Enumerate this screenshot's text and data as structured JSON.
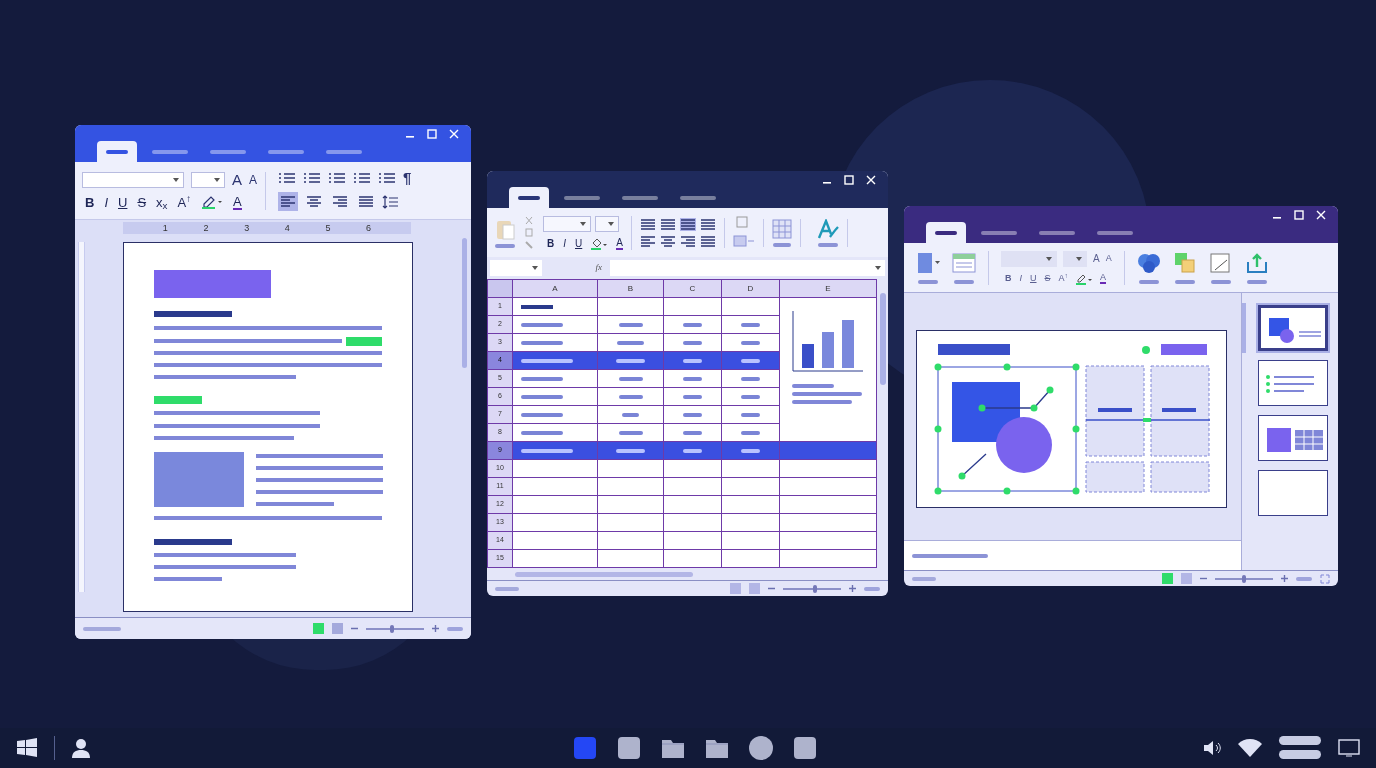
{
  "document_window": {
    "tabs": [
      {
        "selected": true
      },
      {
        "selected": false
      },
      {
        "selected": false
      },
      {
        "selected": false
      },
      {
        "selected": false
      }
    ],
    "font_size_buttons": [
      "A",
      "A"
    ],
    "pilcrow": "¶",
    "format_buttons": [
      "B",
      "I",
      "U",
      "S",
      "x$_{x}$",
      "A$^{↑}$"
    ],
    "font_color": "A",
    "align_buttons": [
      {
        "selected": true
      },
      {
        "selected": false
      },
      {
        "selected": false
      },
      {
        "selected": false
      }
    ],
    "ruler_numbers": [
      "1",
      "2",
      "3",
      "4",
      "5",
      "6"
    ],
    "zoom": {
      "level": 0.45
    }
  },
  "spreadsheet_window": {
    "tabs": [
      {
        "selected": true
      },
      {
        "selected": false
      },
      {
        "selected": false
      },
      {
        "selected": false
      }
    ],
    "format_buttons": [
      "B",
      "I",
      "U"
    ],
    "font_color": "A",
    "formula_label": "fx",
    "columns": [
      "A",
      "B",
      "C",
      "D",
      "E"
    ],
    "rows": [
      {
        "number": "1",
        "selected": false
      },
      {
        "number": "2",
        "selected": false
      },
      {
        "number": "3",
        "selected": false
      },
      {
        "number": "4",
        "selected": true
      },
      {
        "number": "5",
        "selected": false
      },
      {
        "number": "6",
        "selected": false
      },
      {
        "number": "7",
        "selected": false
      },
      {
        "number": "8",
        "selected": false
      },
      {
        "number": "9",
        "selected": true
      },
      {
        "number": "10",
        "selected": false
      },
      {
        "number": "11",
        "selected": false
      },
      {
        "number": "12",
        "selected": false
      },
      {
        "number": "13",
        "selected": false
      },
      {
        "number": "14",
        "selected": false
      },
      {
        "number": "15",
        "selected": false
      }
    ],
    "zoom": {
      "level": 0.55
    }
  },
  "presentation_window": {
    "tabs": [
      {
        "selected": true
      },
      {
        "selected": false
      },
      {
        "selected": false
      },
      {
        "selected": false
      }
    ],
    "font_size_buttons": [
      "A",
      "A"
    ],
    "format_buttons": [
      "B",
      "I",
      "U",
      "S",
      "A$^{↑}$"
    ],
    "font_color": "A",
    "slides": [
      {
        "kind": "shapes",
        "selected": true
      },
      {
        "kind": "list",
        "selected": false
      },
      {
        "kind": "table",
        "selected": false
      },
      {
        "kind": "blank",
        "selected": false
      }
    ],
    "zoom": {
      "level": 0.5
    }
  },
  "taskbar": {
    "apps": [
      {
        "kind": "square",
        "selected": true
      },
      {
        "kind": "square",
        "selected": false
      },
      {
        "kind": "folder",
        "selected": false
      },
      {
        "kind": "folder",
        "selected": false
      },
      {
        "kind": "circle",
        "selected": false
      },
      {
        "kind": "square",
        "selected": false
      }
    ]
  }
}
